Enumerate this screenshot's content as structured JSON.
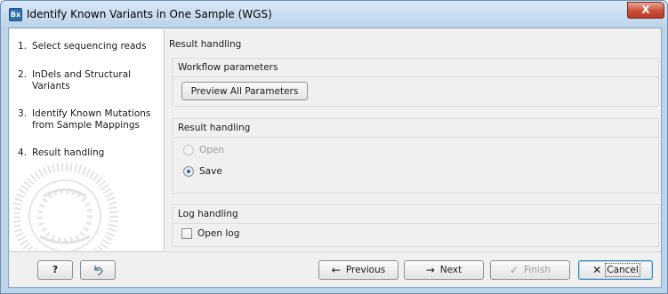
{
  "window": {
    "app_icon_text": "Bx",
    "title": "Identify Known Variants in One Sample (WGS)",
    "close_label": "X"
  },
  "steps": [
    {
      "num": "1.",
      "label": "Select sequencing reads"
    },
    {
      "num": "2.",
      "label": "InDels and Structural Variants"
    },
    {
      "num": "3.",
      "label": "Identify Known Mutations from Sample Mappings"
    },
    {
      "num": "4.",
      "label": "Result handling"
    }
  ],
  "content": {
    "section_title": "Result handling",
    "workflow_group": {
      "title": "Workflow parameters",
      "preview_button": "Preview All Parameters"
    },
    "result_group": {
      "title": "Result handling",
      "options": [
        {
          "label": "Open",
          "checked": false,
          "disabled": true
        },
        {
          "label": "Save",
          "checked": true,
          "disabled": false
        }
      ]
    },
    "log_group": {
      "title": "Log handling",
      "open_log_label": "Open log",
      "open_log_checked": false
    }
  },
  "footer": {
    "help_label": "?",
    "reset_icon": "undo-icon",
    "previous_label": "Previous",
    "next_label": "Next",
    "finish_label": "Finish",
    "cancel_label": "Cancel"
  }
}
